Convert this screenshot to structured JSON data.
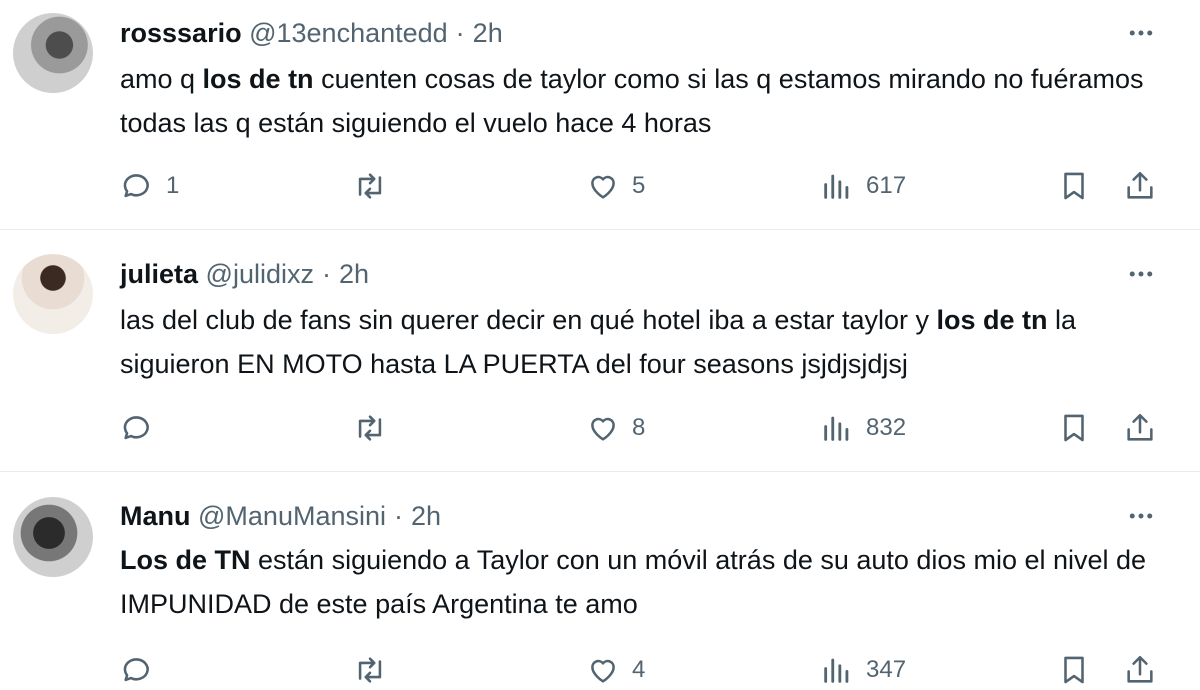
{
  "tweets": [
    {
      "name": "rosssario",
      "handle": "@13enchantedd",
      "separator": "·",
      "time": "2h",
      "text_parts": [
        {
          "text": "amo q ",
          "bold": false
        },
        {
          "text": "los de tn",
          "bold": true
        },
        {
          "text": " cuenten cosas de taylor como si las q estamos mirando no fuéramos todas las q están siguiendo el vuelo hace 4 horas",
          "bold": false
        }
      ],
      "replies": "1",
      "retweets": "",
      "likes": "5",
      "views": "617"
    },
    {
      "name": "julieta",
      "handle": "@julidixz",
      "separator": "·",
      "time": "2h",
      "text_parts": [
        {
          "text": "las del club de fans sin querer decir en qué hotel iba a estar taylor y ",
          "bold": false
        },
        {
          "text": "los de tn",
          "bold": true
        },
        {
          "text": " la siguieron EN MOTO hasta LA PUERTA del four seasons jsjdjsjdjsj",
          "bold": false
        }
      ],
      "replies": "",
      "retweets": "",
      "likes": "8",
      "views": "832"
    },
    {
      "name": "Manu",
      "handle": "@ManuMansini",
      "separator": "·",
      "time": "2h",
      "text_parts": [
        {
          "text": "Los de TN",
          "bold": true
        },
        {
          "text": " están siguiendo a Taylor con un móvil atrás de su auto dios mio el nivel de IMPUNIDAD de este país Argentina te amo",
          "bold": false
        }
      ],
      "replies": "",
      "retweets": "",
      "likes": "4",
      "views": "347"
    }
  ],
  "icons": {
    "more": "more-horizontal-icon",
    "reply": "reply-icon",
    "retweet": "retweet-icon",
    "like": "heart-icon",
    "views": "views-icon",
    "bookmark": "bookmark-icon",
    "share": "share-icon"
  },
  "colors": {
    "text": "#0f1419",
    "muted": "#536471",
    "divider": "#e6ecf0",
    "background": "#ffffff"
  }
}
